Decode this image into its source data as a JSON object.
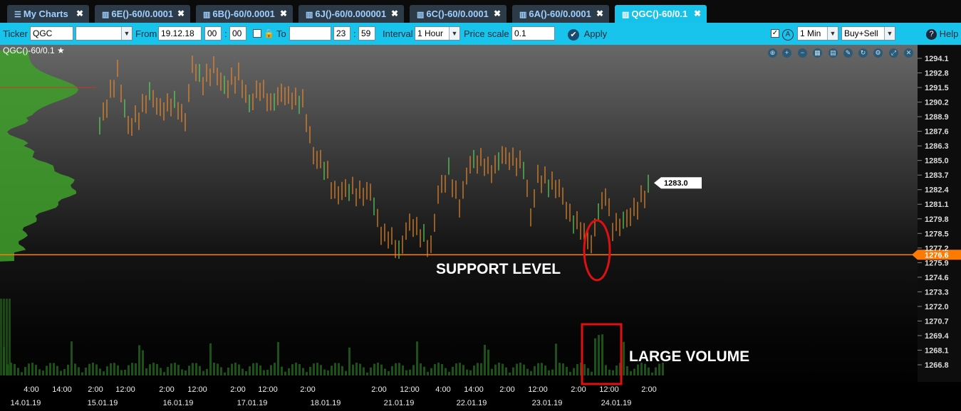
{
  "tabs": [
    {
      "label": "My Charts",
      "icon": "menu-icon",
      "active": false
    },
    {
      "label": "6E()-60/0.0001",
      "icon": "bar-chart-icon",
      "active": false
    },
    {
      "label": "6B()-60/0.0001",
      "icon": "bar-chart-icon",
      "active": false
    },
    {
      "label": "6J()-60/0.000001",
      "icon": "bar-chart-icon",
      "active": false
    },
    {
      "label": "6C()-60/0.0001",
      "icon": "bar-chart-icon",
      "active": false
    },
    {
      "label": "6A()-60/0.0001",
      "icon": "bar-chart-icon",
      "active": false
    },
    {
      "label": "QGC()-60/0.1",
      "icon": "bar-chart-icon",
      "active": true
    }
  ],
  "toolbar": {
    "ticker_label": "Ticker",
    "ticker_value": "QGC",
    "from_label": "From",
    "from_date": "19.12.18",
    "from_hour": "00",
    "from_min": "00",
    "to_label": "To",
    "to_date": "",
    "to_hour": "23",
    "to_min": "59",
    "interval_label": "Interval",
    "interval_value": "1 Hour",
    "price_scale_label": "Price scale",
    "price_scale_value": "0.1",
    "apply_label": "Apply",
    "timeframe_value": "1 Min",
    "side_value": "Buy+Sell",
    "help_label": "Help"
  },
  "chart": {
    "title": "QGC()-60/0.1",
    "price_ticks": [
      "1294.1",
      "1292.8",
      "1291.5",
      "1290.2",
      "1288.9",
      "1287.6",
      "1286.3",
      "1285.0",
      "1283.7",
      "1282.4",
      "1281.1",
      "1279.8",
      "1278.5",
      "1277.2",
      "1275.9",
      "1274.6",
      "1273.3",
      "1272.0",
      "1270.7",
      "1269.4",
      "1268.1",
      "1266.8"
    ],
    "last_price": "1283.0",
    "support_price": "1276.6",
    "time_ticks": [
      "4:00",
      "14:00",
      "2:00",
      "12:00",
      "2:00",
      "12:00",
      "2:00",
      "12:00",
      "2:00",
      "2:00",
      "12:00",
      "4:00",
      "14:00",
      "2:00",
      "12:00",
      "2:00",
      "12:00",
      "2:00"
    ],
    "date_ticks": [
      "14.01.19",
      "15.01.19",
      "16.01.19",
      "17.01.19",
      "18.01.19",
      "21.01.19",
      "22.01.19",
      "23.01.19",
      "24.01.19"
    ],
    "annotations": {
      "support": "SUPPORT LEVEL",
      "volume": "LARGE VOLUME"
    },
    "colors": {
      "bar_up": "#e8892a",
      "bar_alt": "#5bd65b",
      "support_line": "#ff7a00",
      "profile": "#3fa02a",
      "annotation": "#e01010"
    }
  }
}
